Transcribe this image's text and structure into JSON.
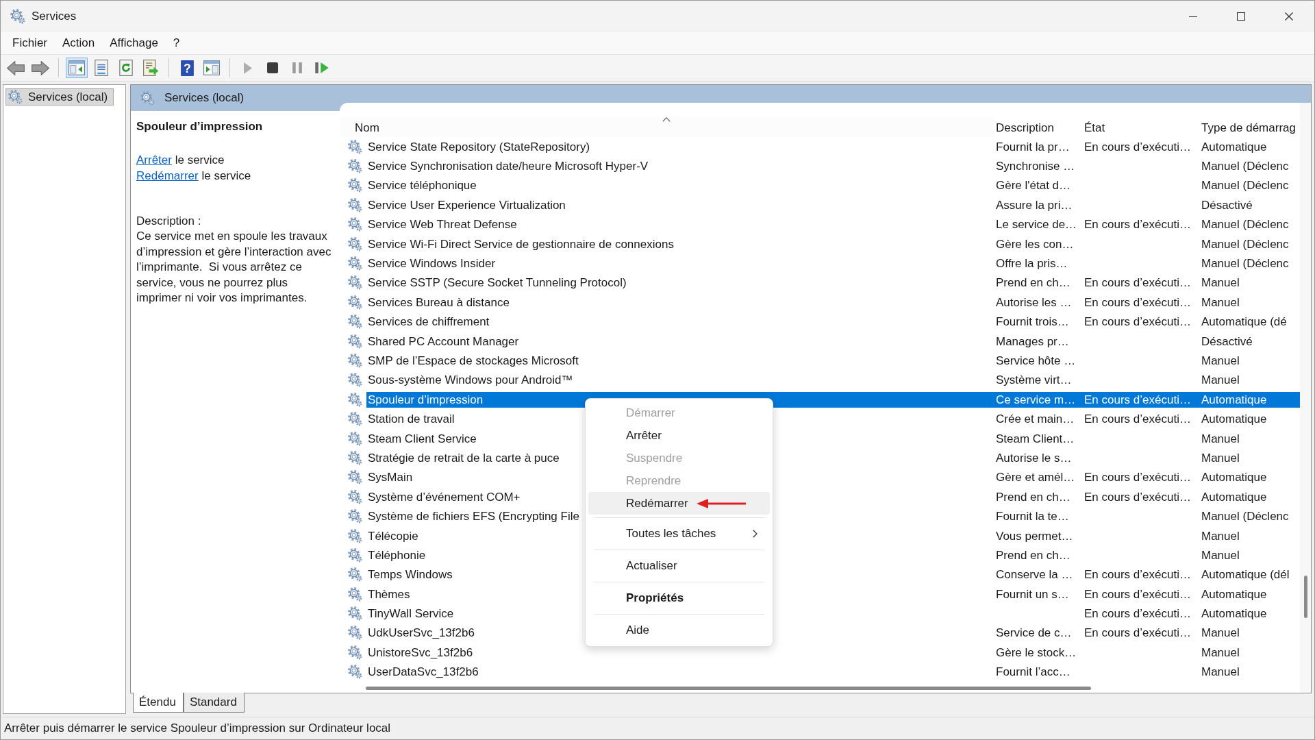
{
  "window": {
    "title": "Services"
  },
  "menu": [
    "Fichier",
    "Action",
    "Affichage",
    "?"
  ],
  "toolbar": [
    [
      {
        "kind": "back",
        "pressed": false,
        "disabled": false
      },
      {
        "kind": "forward",
        "pressed": false,
        "disabled": false
      }
    ],
    [
      {
        "kind": "tree",
        "pressed": true,
        "disabled": false
      },
      {
        "kind": "properties",
        "pressed": false,
        "disabled": false
      },
      {
        "kind": "refresh",
        "pressed": false,
        "disabled": false
      },
      {
        "kind": "export",
        "pressed": false,
        "disabled": false
      }
    ],
    [
      {
        "kind": "help",
        "label": "?",
        "pressed": false,
        "disabled": false
      },
      {
        "kind": "actionpane",
        "pressed": false,
        "disabled": false
      }
    ],
    [
      {
        "kind": "start",
        "pressed": false,
        "disabled": true
      },
      {
        "kind": "stop",
        "pressed": false,
        "disabled": false
      },
      {
        "kind": "pause",
        "pressed": false,
        "disabled": true
      },
      {
        "kind": "restart",
        "pressed": false,
        "disabled": false
      }
    ]
  ],
  "tree": {
    "items": [
      {
        "label": "Services (local)",
        "selected": true
      }
    ]
  },
  "panel": {
    "title": "Services (local)"
  },
  "details": {
    "title": "Spouleur d’impression",
    "actions": [
      {
        "link": "Arrêter",
        "text": "le service"
      },
      {
        "link": "Redémarrer",
        "text": "le service"
      }
    ],
    "description_label": "Description :",
    "description": "Ce service met en spoule les travaux d’impression et gère l’interaction avec l’imprimante.  Si vous arrêtez ce service, vous ne pourrez plus imprimer ni voir vos imprimantes."
  },
  "table": {
    "columns": [
      {
        "label": "Nom",
        "sorted": true
      },
      {
        "label": "Description",
        "sorted": false
      },
      {
        "label": "État",
        "sorted": false
      },
      {
        "label": "Type de démarrag",
        "sorted": false
      }
    ],
    "rows": [
      {
        "name": "Service State Repository (StateRepository)",
        "description": "Fournit la pr…",
        "status": "En cours d’exécuti…",
        "startup": "Automatique",
        "selected": false
      },
      {
        "name": "Service Synchronisation date/heure Microsoft Hyper-V",
        "description": "Synchronise …",
        "startup": "Manuel (Déclenc",
        "selected": false
      },
      {
        "name": "Service téléphonique",
        "description": "Gère l'état d…",
        "startup": "Manuel (Déclenc",
        "selected": false
      },
      {
        "name": "Service User Experience Virtualization",
        "description": "Assure la pri…",
        "startup": "Désactivé",
        "selected": false
      },
      {
        "name": "Service Web Threat Defense",
        "description": "Le service de…",
        "status": "En cours d’exécuti…",
        "startup": "Manuel (Déclenc",
        "selected": false
      },
      {
        "name": "Service Wi-Fi Direct Service de gestionnaire de connexions",
        "description": "Gère les con…",
        "startup": "Manuel (Déclenc",
        "selected": false
      },
      {
        "name": "Service Windows Insider",
        "description": "Offre la pris…",
        "startup": "Manuel (Déclenc",
        "selected": false
      },
      {
        "name": "Service SSTP (Secure Socket Tunneling Protocol)",
        "description": "Prend en ch…",
        "status": "En cours d’exécuti…",
        "startup": "Manuel",
        "selected": false
      },
      {
        "name": "Services Bureau à distance",
        "description": "Autorise les …",
        "status": "En cours d’exécuti…",
        "startup": "Manuel",
        "selected": false
      },
      {
        "name": "Services de chiffrement",
        "description": "Fournit trois…",
        "status": "En cours d’exécuti…",
        "startup": "Automatique (dé",
        "selected": false
      },
      {
        "name": "Shared PC Account Manager",
        "description": "Manages pr…",
        "startup": "Désactivé",
        "selected": false
      },
      {
        "name": "SMP de l’Espace de stockages Microsoft",
        "description": "Service hôte …",
        "startup": "Manuel",
        "selected": false
      },
      {
        "name": "Sous-système Windows pour Android™",
        "description": "Système virt…",
        "startup": "Manuel",
        "selected": false
      },
      {
        "name": "Spouleur d’impression",
        "description": "Ce service m…",
        "status": "En cours d’exécuti…",
        "startup": "Automatique",
        "selected": true
      },
      {
        "name": "Station de travail",
        "description": "Crée et main…",
        "status": "En cours d’exécuti…",
        "startup": "Automatique",
        "selected": false
      },
      {
        "name": "Steam Client Service",
        "description": "Steam Client…",
        "startup": "Manuel",
        "selected": false
      },
      {
        "name": "Stratégie de retrait de la carte à puce",
        "description": "Autorise le s…",
        "startup": "Manuel",
        "selected": false
      },
      {
        "name": "SysMain",
        "description": "Gère et amél…",
        "status": "En cours d’exécuti…",
        "startup": "Automatique",
        "selected": false
      },
      {
        "name": "Système d’événement COM+",
        "description": "Prend en ch…",
        "status": "En cours d’exécuti…",
        "startup": "Automatique",
        "selected": false
      },
      {
        "name": "Système de fichiers EFS (Encrypting File",
        "description": "Fournit la te…",
        "startup": "Manuel (Déclenc",
        "selected": false
      },
      {
        "name": "Télécopie",
        "description": "Vous permet…",
        "startup": "Manuel",
        "selected": false
      },
      {
        "name": "Téléphonie",
        "description": "Prend en ch…",
        "startup": "Manuel",
        "selected": false
      },
      {
        "name": "Temps Windows",
        "description": "Conserve la …",
        "status": "En cours d’exécuti…",
        "startup": "Automatique (dél",
        "selected": false
      },
      {
        "name": "Thèmes",
        "description": "Fournit un s…",
        "status": "En cours d’exécuti…",
        "startup": "Automatique",
        "selected": false
      },
      {
        "name": "TinyWall Service",
        "status": "En cours d’exécuti…",
        "startup": "Automatique",
        "selected": false
      },
      {
        "name": "UdkUserSvc_13f2b6",
        "description": "Service de c…",
        "status": "En cours d’exécuti…",
        "startup": "Manuel",
        "selected": false
      },
      {
        "name": "UnistoreSvc_13f2b6",
        "description": "Gère le stock…",
        "startup": "Manuel",
        "selected": false
      },
      {
        "name": "UserDataSvc_13f2b6",
        "description": "Fournit l’acc…",
        "startup": "Manuel",
        "selected": false
      }
    ]
  },
  "context_menu": {
    "items": [
      {
        "kind": "item",
        "label": "Démarrer",
        "disabled": true,
        "highlighted": false,
        "default": false,
        "submenu": false,
        "marked": false
      },
      {
        "kind": "item",
        "label": "Arrêter",
        "disabled": false,
        "highlighted": false,
        "default": false,
        "submenu": false,
        "marked": false
      },
      {
        "kind": "item",
        "label": "Suspendre",
        "disabled": true,
        "highlighted": false,
        "default": false,
        "submenu": false,
        "marked": false
      },
      {
        "kind": "item",
        "label": "Reprendre",
        "disabled": true,
        "highlighted": false,
        "default": false,
        "submenu": false,
        "marked": false
      },
      {
        "kind": "item",
        "label": "Redémarrer",
        "disabled": false,
        "highlighted": true,
        "default": false,
        "submenu": false,
        "marked": true
      },
      {
        "kind": "separator"
      },
      {
        "kind": "item",
        "label": "Toutes les tâches",
        "disabled": false,
        "highlighted": false,
        "default": false,
        "submenu": true,
        "marked": false
      },
      {
        "kind": "separator"
      },
      {
        "kind": "item",
        "label": "Actualiser",
        "disabled": false,
        "highlighted": false,
        "default": false,
        "submenu": false,
        "marked": false
      },
      {
        "kind": "separator"
      },
      {
        "kind": "item",
        "label": "Propriétés",
        "disabled": false,
        "highlighted": false,
        "default": true,
        "submenu": false,
        "marked": false
      },
      {
        "kind": "separator"
      },
      {
        "kind": "item",
        "label": "Aide",
        "disabled": false,
        "highlighted": false,
        "default": false,
        "submenu": false,
        "marked": false
      }
    ]
  },
  "view_tabs": [
    {
      "label": "Étendu",
      "selected": true
    },
    {
      "label": "Standard",
      "selected": false
    }
  ],
  "status_bar": "Arrêter puis démarrer le service Spouleur d’impression sur Ordinateur local"
}
